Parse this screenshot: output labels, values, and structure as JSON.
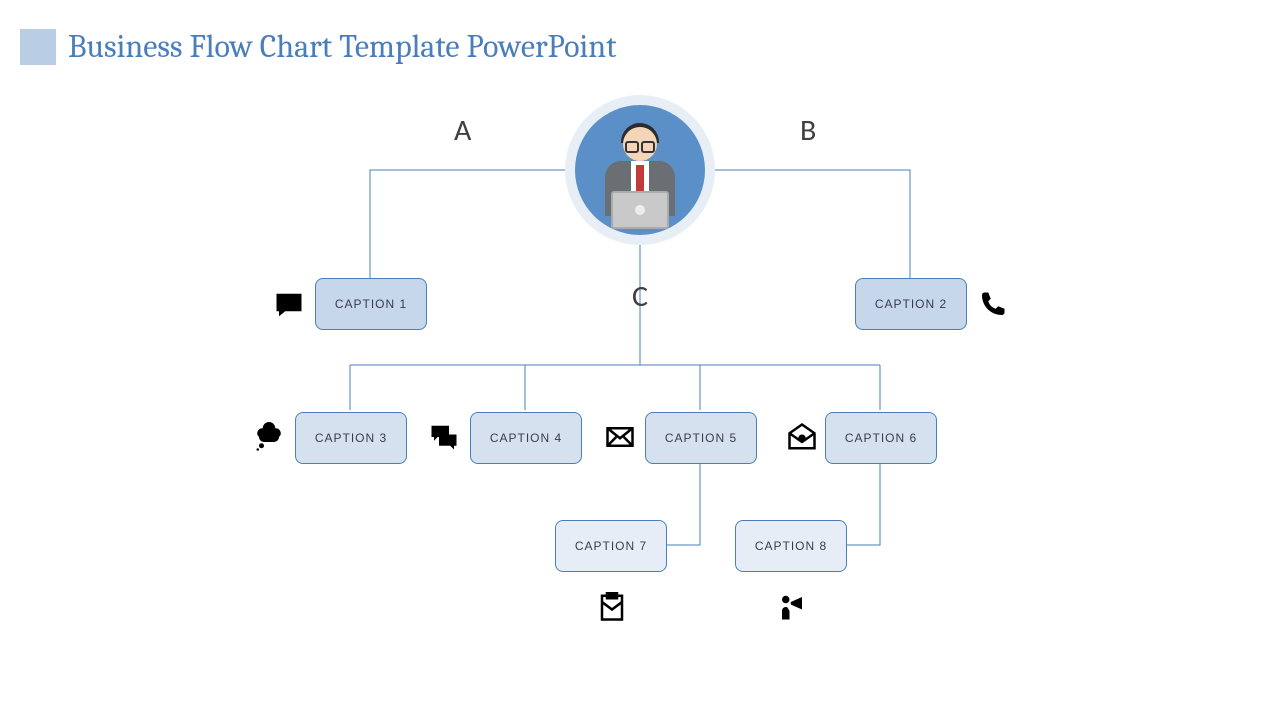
{
  "page_title": "Business Flow Chart Template PowerPoint",
  "branch_labels": {
    "a": "A",
    "b": "B",
    "c": "C"
  },
  "captions": {
    "c1": "CAPTION 1",
    "c2": "CAPTION 2",
    "c3": "CAPTION 3",
    "c4": "CAPTION 4",
    "c5": "CAPTION 5",
    "c6": "CAPTION 6",
    "c7": "CAPTION 7",
    "c8": "CAPTION 8"
  },
  "icons": {
    "c1": "speech-bubble-icon",
    "c2": "phone-icon",
    "c3": "thought-bubble-icon",
    "c4": "chat-bubbles-icon",
    "c5": "envelope-icon",
    "c6": "open-envelope-icon",
    "c7": "clipboard-mail-icon",
    "c8": "megaphone-person-icon"
  }
}
